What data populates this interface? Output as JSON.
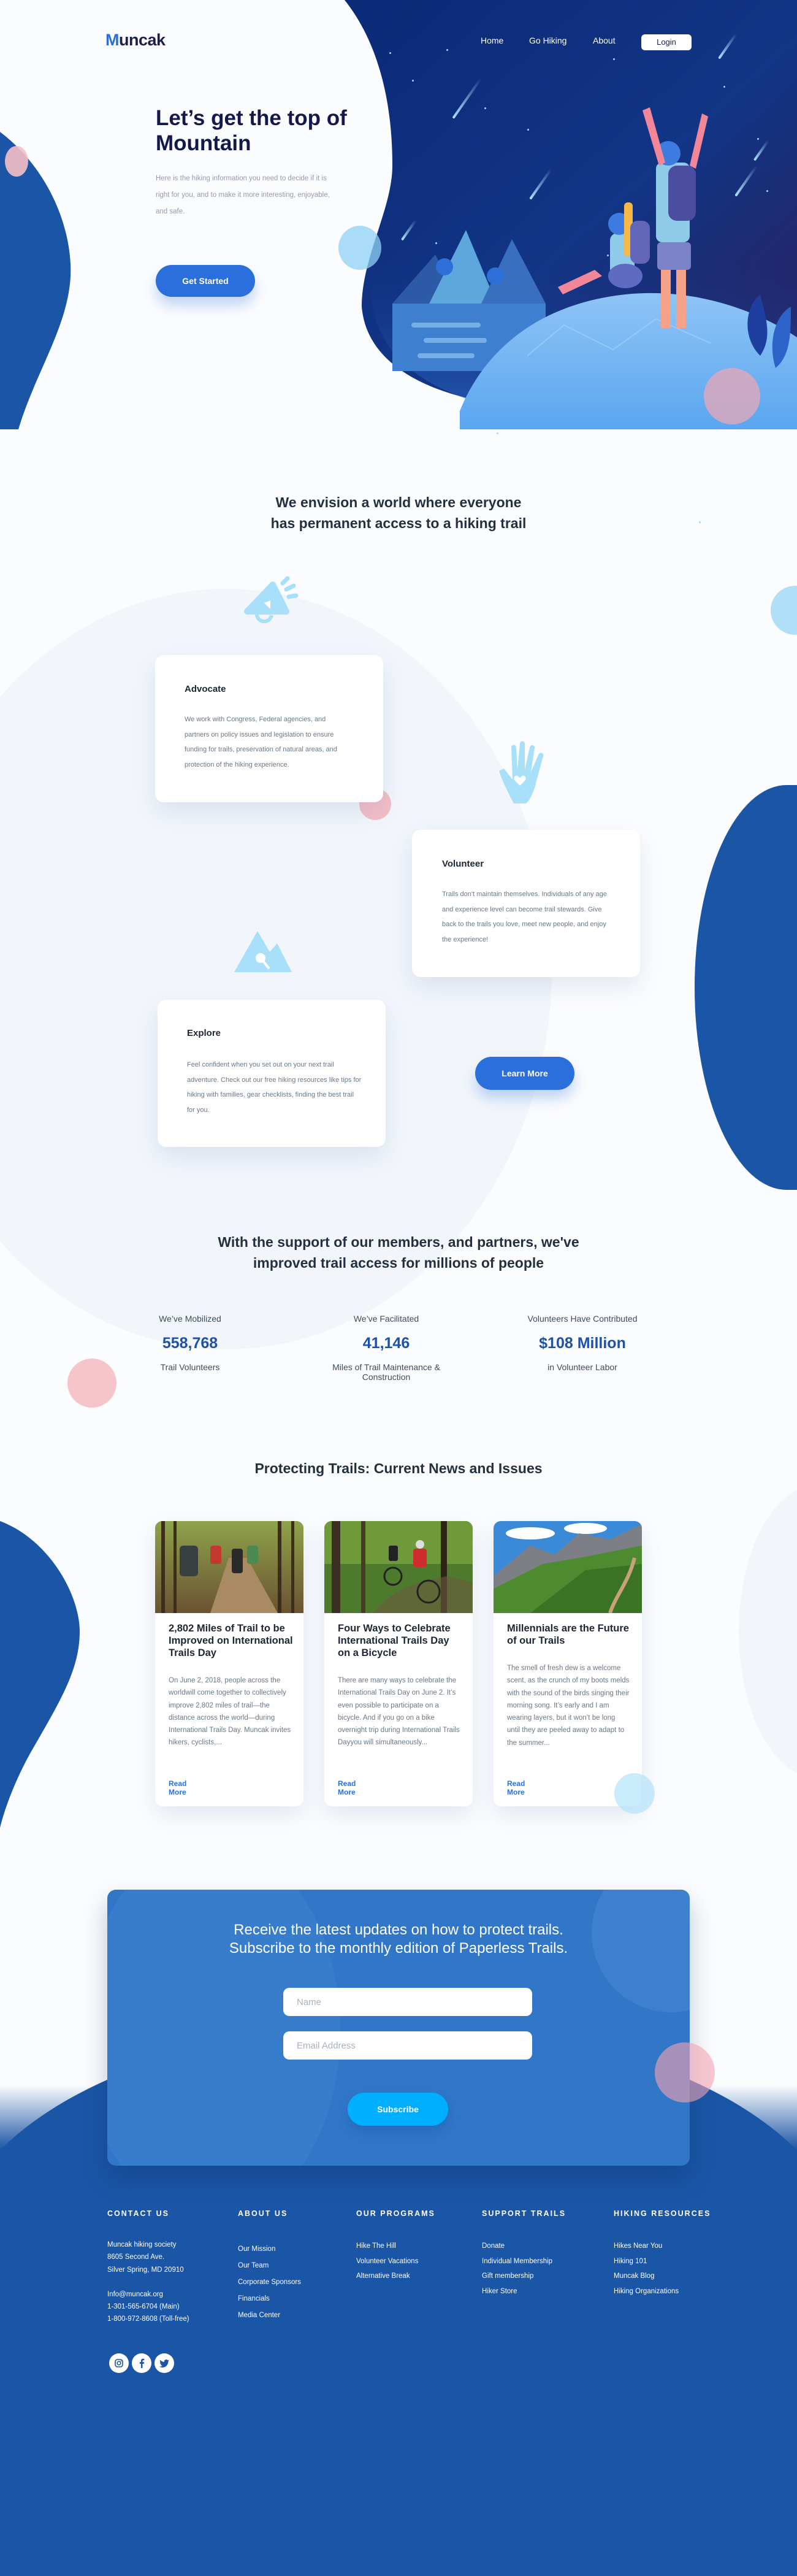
{
  "brand": {
    "logo_first": "M",
    "logo_rest": "uncak",
    "accent": "#2a6fdb",
    "dark": "#15184a",
    "footer_blue": "#1b55a5"
  },
  "nav": {
    "links": [
      "Home",
      "Go Hiking",
      "About"
    ],
    "login_label": "Login"
  },
  "hero": {
    "title": "Let’s get the top of Mountain",
    "subtitle": "Here is the hiking information you need to decide if it is right for you, and to make it more interesting, enjoyable, and safe.",
    "cta_label": "Get Started"
  },
  "vision": {
    "title_line1": "We envision a world  where everyone",
    "title_line2": "has permanent access to a hiking trail",
    "cards": [
      {
        "icon": "megaphone-icon",
        "title": "Advocate",
        "text": "We work with Congress, Federal agencies, and partners on policy issues and legislation to ensure funding for trails, preservation of natural areas, and protection of the hiking experience."
      },
      {
        "icon": "hand-heart-icon",
        "title": "Volunteer",
        "text": "Trails don't maintain themselves. Individuals of any age and experience level can become trail stewards. Give back to the trails you love, meet new people, and enjoy the experience!"
      },
      {
        "icon": "mountain-search-icon",
        "title": "Explore",
        "text": "Feel confident when you set out on your next trail adventure. Check out our free hiking resources like tips for hiking with families, gear checklists, finding the best trail for you."
      }
    ],
    "learn_more_label": "Learn More"
  },
  "stats": {
    "title_line1": "With the support of our members,  and partners, we've",
    "title_line2": "improved trail access for millions of people",
    "items": [
      {
        "label": "We’ve Mobilized",
        "value": "558,768",
        "sub": "Trail Volunteers"
      },
      {
        "label": "We’ve Facilitated",
        "value": "41,146",
        "sub": "Miles of Trail Maintenance & Construction"
      },
      {
        "label": "Volunteers Have Contributed",
        "value": "$108 Million",
        "sub": "in Volunteer Labor"
      }
    ]
  },
  "news": {
    "title": "Protecting Trails: Current News and Issues",
    "read_more_label": "Read More",
    "articles": [
      {
        "image": "hikers-on-forest-trail",
        "title": "2,802 Miles of Trail to be Improved on International Trails Day",
        "excerpt": "On June 2, 2018, people across the worldwill come together to collectively improve 2,802 miles of trail—the distance across the world—during International Trails Day. Muncak invites hikers, cyclists,..."
      },
      {
        "image": "cyclists-in-forest",
        "title": "Four Ways to Celebrate International Trails Day on a Bicycle",
        "excerpt": "There are many ways to celebrate the International Trails Day on June 2. It’s even possible to participate on a bicycle. And if you go on a bike overnight trip during International Trails Dayyou will simultaneously..."
      },
      {
        "image": "mountain-trail-landscape",
        "title": "Millennials are the Future of our Trails",
        "excerpt": "The smell of fresh dew is a welcome scent, as the crunch of my boots melds with the sound of the birds singing their morning song. It’s early and I am wearing layers, but it won’t be long until they are peeled away to adapt to the summer..."
      }
    ]
  },
  "newsletter": {
    "title_line1": "Receive the latest updates on how to protect trails.",
    "title_line2": "Subscribe to the monthly edition of Paperless Trails.",
    "name_placeholder": "Name",
    "email_placeholder": "Email Address",
    "subscribe_label": "Subscribe"
  },
  "footer": {
    "contact": {
      "heading": "CONTACT US",
      "address": [
        "Muncak hiking society",
        "8605 Second Ave.",
        "Silver Spring, MD 20910"
      ],
      "contact_lines": [
        "Info@muncak.org",
        "1-301-565-6704 (Main)",
        "1-800-972-8608 (Toll-free)"
      ]
    },
    "columns": [
      {
        "heading": "ABOUT US",
        "links": [
          "Our Mission",
          "Our Team",
          "Corporate Sponsors",
          "Financials",
          "Media Center"
        ]
      },
      {
        "heading": "OUR PROGRAMS",
        "links": [
          "Hike The Hill",
          "Volunteer Vacations",
          "Alternative Break"
        ]
      },
      {
        "heading": "SUPPORT TRAILS",
        "links": [
          "Donate",
          "Individual Membership",
          "Gift membership",
          "Hiker Store"
        ]
      },
      {
        "heading": "HIKING RESOURCES",
        "links": [
          "Hikes Near You",
          "Hiking 101",
          "Muncak Blog",
          "Hiking Organizations"
        ]
      }
    ],
    "social": [
      "instagram-icon",
      "facebook-icon",
      "twitter-icon"
    ]
  }
}
